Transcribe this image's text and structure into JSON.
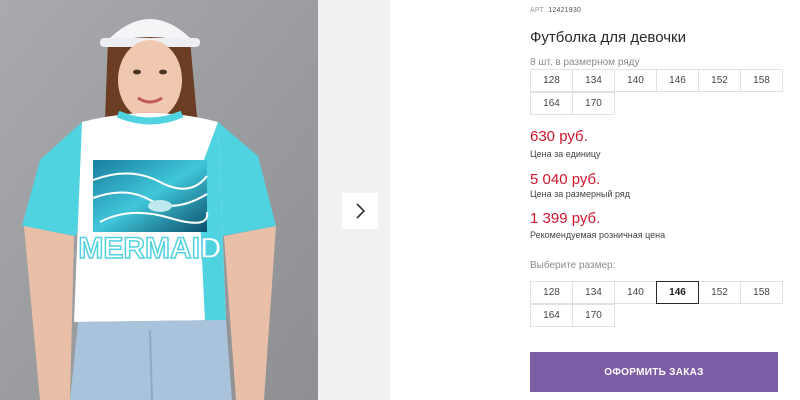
{
  "product": {
    "art_label": "АРТ.",
    "art_number": "12421930",
    "title": "Футболка для девочки",
    "row_note": "8 шт. в размерном ряду",
    "row_sizes": [
      "128",
      "134",
      "140",
      "146",
      "152",
      "158",
      "164",
      "170"
    ],
    "prices": [
      {
        "value": "630 руб.",
        "label": "Цена за единицу"
      },
      {
        "value": "5 040 руб.",
        "label": "Цена за размерный ряд"
      },
      {
        "value": "1 399 руб.",
        "label": "Рекомендуемая розничная цена"
      }
    ],
    "choose_label": "Выберите размер:",
    "size_options": [
      "128",
      "134",
      "140",
      "146",
      "152",
      "158",
      "164",
      "170"
    ],
    "selected_size": "146",
    "order_button": "ОФОРМИТЬ ЗАКАЗ"
  },
  "gallery": {
    "next_icon": "chevron-right-icon",
    "print_text": "MERMAID"
  },
  "colors": {
    "accent": "#7d5ea6",
    "price": "#d0152e",
    "shirt_turquoise": "#4fd3e0"
  }
}
